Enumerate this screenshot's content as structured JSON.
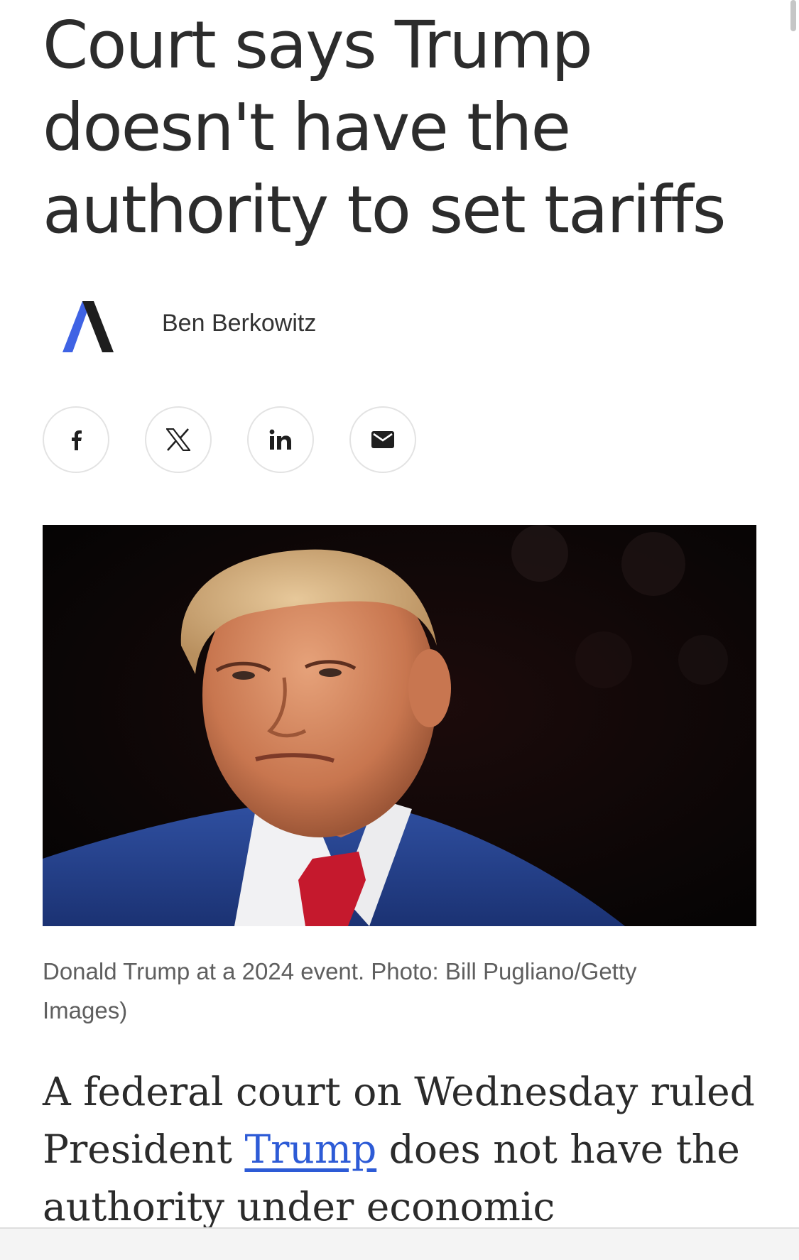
{
  "article": {
    "headline": "Court says Trump doesn't have the authority to set tariffs",
    "author": "Ben Berkowitz",
    "brand_colors": {
      "logo_blue": "#3f63e4",
      "logo_dark": "#1e1e1e",
      "link": "#2d5bd6"
    }
  },
  "share": {
    "buttons": [
      {
        "name": "facebook",
        "icon": "facebook-icon"
      },
      {
        "name": "x",
        "icon": "x-icon"
      },
      {
        "name": "linkedin",
        "icon": "linkedin-icon"
      },
      {
        "name": "email",
        "icon": "mail-icon"
      }
    ]
  },
  "photo": {
    "caption": "Donald Trump at a 2024 event. Photo: Bill Pugliano/Getty Images)"
  },
  "body": {
    "lead_before": "A federal court on Wednesday ruled President ",
    "lead_link": "Trump",
    "lead_after": " does not have the authority under economic emergency"
  }
}
